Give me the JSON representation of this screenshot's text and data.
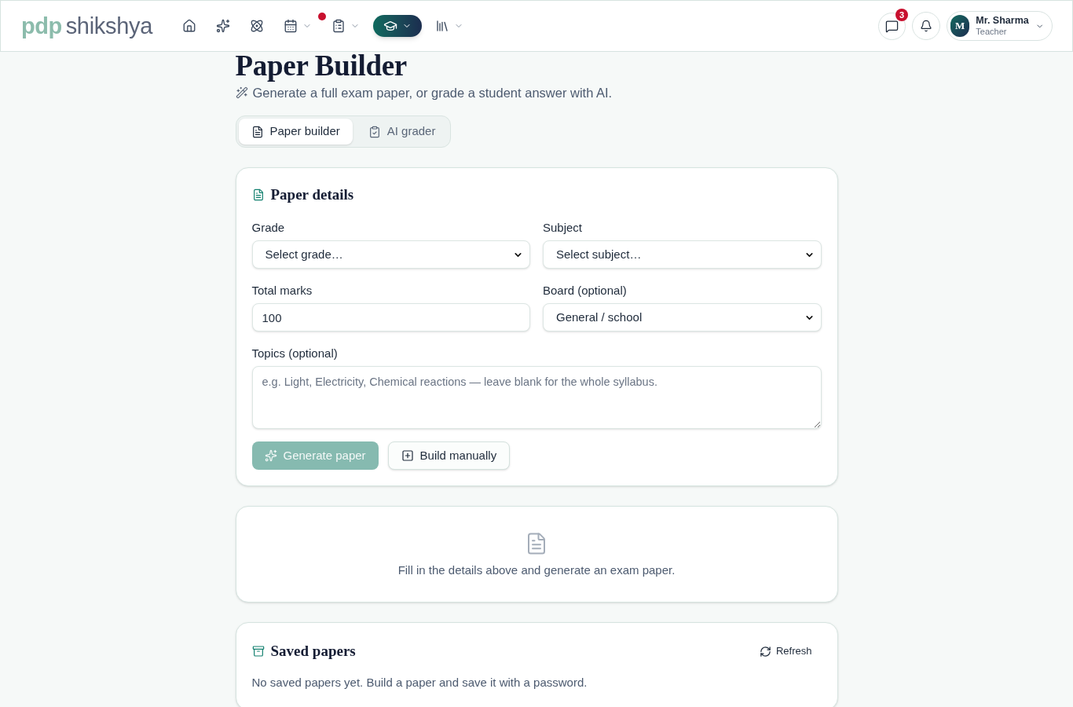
{
  "header": {
    "logo": {
      "brand": "pdp",
      "name": "shikshya"
    },
    "nav": [
      {
        "selected": false,
        "menu": false,
        "alert": false
      },
      {
        "selected": false,
        "menu": false,
        "alert": false
      },
      {
        "selected": false,
        "menu": false,
        "alert": false
      },
      {
        "selected": false,
        "menu": true,
        "alert": true
      },
      {
        "selected": false,
        "menu": true,
        "alert": false
      },
      {
        "selected": true,
        "menu": true,
        "alert": false
      },
      {
        "selected": false,
        "menu": true,
        "alert": false
      }
    ],
    "messages": {
      "badge": "3"
    },
    "user": {
      "initial": "M",
      "name": "Mr. Sharma",
      "role": "Teacher"
    }
  },
  "page": {
    "title": "Paper Builder",
    "subtitle": "Generate a full exam paper, or grade a student answer with AI."
  },
  "tabs": [
    {
      "label": "Paper builder",
      "selected": true
    },
    {
      "label": "AI grader",
      "selected": false
    }
  ],
  "paper_details": {
    "title": "Paper details",
    "fields": [
      {
        "label": "Grade",
        "kind": "select",
        "value": "Select grade…"
      },
      {
        "label": "Subject",
        "kind": "select",
        "value": "Select subject…"
      },
      {
        "label": "Total marks",
        "kind": "input",
        "value": "100"
      },
      {
        "label": "Board (optional)",
        "kind": "select",
        "value": "General / school"
      }
    ],
    "topics": {
      "label": "Topics (optional)",
      "placeholder": "e.g. Light, Electricity, Chemical reactions — leave blank for the whole syllabus."
    },
    "buttons": [
      {
        "label": "Generate paper",
        "kind": "primary",
        "disabled": true
      },
      {
        "label": "Build manually",
        "kind": "secondary",
        "disabled": false
      }
    ]
  },
  "empty_state": {
    "message": "Fill in the details above and generate an exam paper."
  },
  "saved_papers": {
    "title": "Saved papers",
    "refresh": "Refresh",
    "message": "No saved papers yet. Build a paper and save it with a password."
  }
}
